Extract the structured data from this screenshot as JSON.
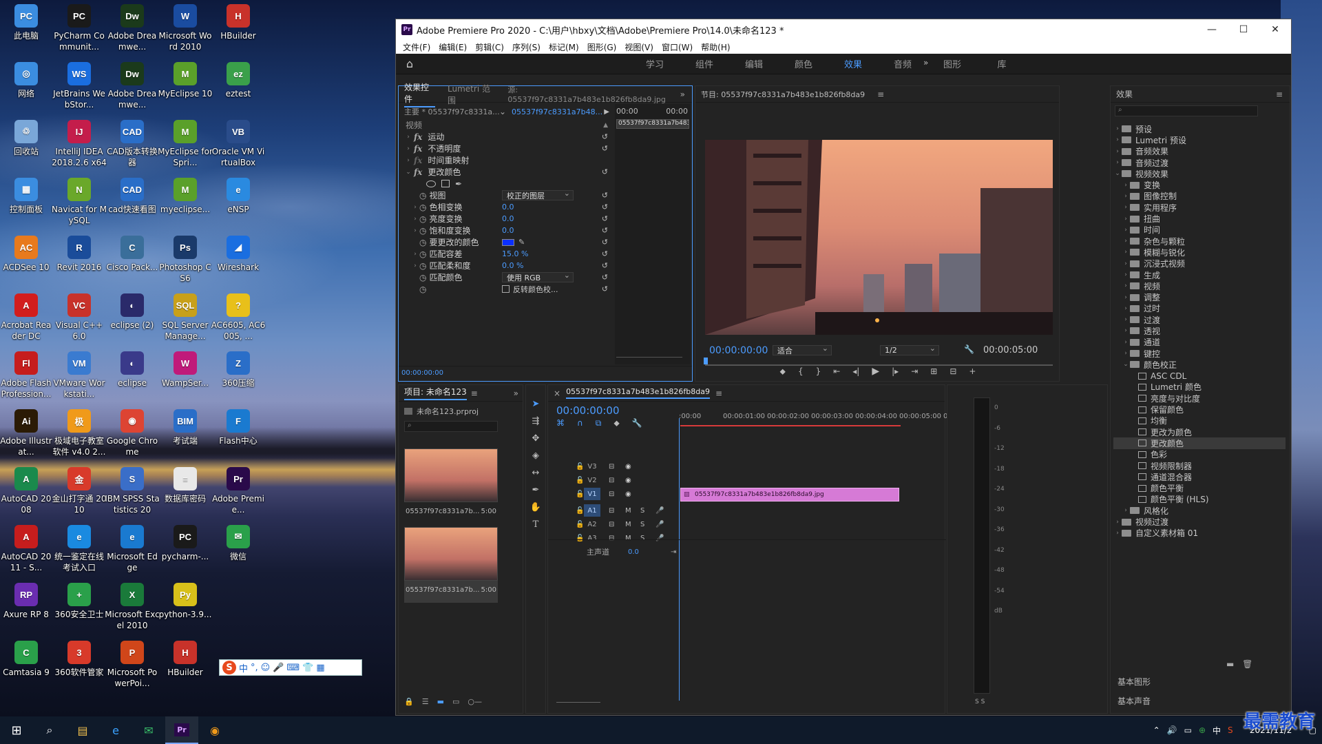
{
  "desktop": {
    "icons": [
      {
        "label": "此电脑",
        "color": "#3b8de0",
        "glyph": "PC"
      },
      {
        "label": "网络",
        "color": "#3b8de0",
        "glyph": "◎"
      },
      {
        "label": "回收站",
        "color": "#7aa7d8",
        "glyph": "♲"
      },
      {
        "label": "控制面板",
        "color": "#3b8de0",
        "glyph": "▦"
      },
      {
        "label": "ACDSee 10",
        "color": "#e87a1d",
        "glyph": "AC"
      },
      {
        "label": "Acrobat Reader DC",
        "color": "#d21d1d",
        "glyph": "A"
      },
      {
        "label": "Adobe Flash Profession...",
        "color": "#c61d1d",
        "glyph": "Fl"
      },
      {
        "label": "Adobe Illustrat...",
        "color": "#2b1b05",
        "glyph": "Ai"
      },
      {
        "label": "AutoCAD 2008",
        "color": "#1a8a4c",
        "glyph": "A"
      },
      {
        "label": "AutoCAD 2011 - S...",
        "color": "#c61d1d",
        "glyph": "A"
      },
      {
        "label": "Axure RP 8",
        "color": "#6a2db0",
        "glyph": "RP"
      },
      {
        "label": "Camtasia 9",
        "color": "#2aa04a",
        "glyph": "C"
      },
      {
        "label": "PyCharm Communit...",
        "color": "#1a1a1a",
        "glyph": "PC"
      },
      {
        "label": "JetBrains WebStor...",
        "color": "#1a6ee0",
        "glyph": "WS"
      },
      {
        "label": "IntelliJ IDEA 2018.2.6 x64",
        "color": "#c41d4b",
        "glyph": "IJ"
      },
      {
        "label": "Navicat for MySQL",
        "color": "#6aa82a",
        "glyph": "N"
      },
      {
        "label": "Revit 2016",
        "color": "#1a4c9a",
        "glyph": "R"
      },
      {
        "label": "Visual C++ 6.0",
        "color": "#c8322a",
        "glyph": "VC"
      },
      {
        "label": "VMware Workstati...",
        "color": "#3a7bd0",
        "glyph": "VM"
      },
      {
        "label": "极域电子教室软件 v4.0 2...",
        "color": "#f09a1a",
        "glyph": "极"
      },
      {
        "label": "金山打字通 2010",
        "color": "#d83a2a",
        "glyph": "金"
      },
      {
        "label": "统一鉴定在线考试入口",
        "color": "#1a8ae0",
        "glyph": "e"
      },
      {
        "label": "360安全卫士",
        "color": "#2aa04a",
        "glyph": "+"
      },
      {
        "label": "360软件管家",
        "color": "#d83a2a",
        "glyph": "3"
      },
      {
        "label": "Adobe Dreamwe...",
        "color": "#1b3a1b",
        "glyph": "Dw"
      },
      {
        "label": "Adobe Dreamwe...",
        "color": "#1b3a1b",
        "glyph": "Dw"
      },
      {
        "label": "CAD版本转换器",
        "color": "#2a6ec8",
        "glyph": "CAD"
      },
      {
        "label": "cad快速看图",
        "color": "#2a6ec8",
        "glyph": "CAD"
      },
      {
        "label": "Cisco Pack...",
        "color": "#3a6e9a",
        "glyph": "C"
      },
      {
        "label": "eclipse (2)",
        "color": "#2a2a6a",
        "glyph": "◐"
      },
      {
        "label": "eclipse",
        "color": "#3a3a8a",
        "glyph": "◐"
      },
      {
        "label": "Google Chrome",
        "color": "#dd4433",
        "glyph": "◉"
      },
      {
        "label": "IBM SPSS Statistics 20",
        "color": "#3a6ec8",
        "glyph": "S"
      },
      {
        "label": "Microsoft Edge",
        "color": "#1a7ad0",
        "glyph": "e"
      },
      {
        "label": "Microsoft Excel 2010",
        "color": "#1a7a3a",
        "glyph": "X"
      },
      {
        "label": "Microsoft PowerPoi...",
        "color": "#d0461a",
        "glyph": "P"
      },
      {
        "label": "Microsoft Word 2010",
        "color": "#1a4ca0",
        "glyph": "W"
      },
      {
        "label": "MyEclipse 10",
        "color": "#5aa02a",
        "glyph": "M"
      },
      {
        "label": "MyEclipse for Spri...",
        "color": "#5aa02a",
        "glyph": "M"
      },
      {
        "label": "myeclipse...",
        "color": "#5aa02a",
        "glyph": "M"
      },
      {
        "label": "Photoshop CS6",
        "color": "#1a3a6a",
        "glyph": "Ps"
      },
      {
        "label": "SQL Server Manage...",
        "color": "#c8a01a",
        "glyph": "SQL"
      },
      {
        "label": "WampSer...",
        "color": "#c01a7a",
        "glyph": "W"
      },
      {
        "label": "考试端",
        "color": "#2a6ec8",
        "glyph": "BIM"
      },
      {
        "label": "数据库密码",
        "color": "#e8e8e8",
        "glyph": "≡"
      },
      {
        "label": "pycharm-...",
        "color": "#1a1a1a",
        "glyph": "PC"
      },
      {
        "label": "python-3.9...",
        "color": "#d8c01a",
        "glyph": "Py"
      },
      {
        "label": "HBuilder",
        "color": "#c8322a",
        "glyph": "H"
      },
      {
        "label": "HBuilder",
        "color": "#c8322a",
        "glyph": "H"
      },
      {
        "label": "eztest",
        "color": "#3aa04a",
        "glyph": "ez"
      },
      {
        "label": "Oracle VM VirtualBox",
        "color": "#2a4c8a",
        "glyph": "VB"
      },
      {
        "label": "eNSP",
        "color": "#2a8ae0",
        "glyph": "e"
      },
      {
        "label": "Wireshark",
        "color": "#1a6ee0",
        "glyph": "◢"
      },
      {
        "label": "AC6605, AC6005, ...",
        "color": "#e8c01a",
        "glyph": "?"
      },
      {
        "label": "360压缩",
        "color": "#2a6ec8",
        "glyph": "Z"
      },
      {
        "label": "Flash中心",
        "color": "#1a7ad0",
        "glyph": "F"
      },
      {
        "label": "Adobe Premie...",
        "color": "#2a0a4a",
        "glyph": "Pr"
      },
      {
        "label": "微信",
        "color": "#2aa04a",
        "glyph": "✉"
      }
    ]
  },
  "taskbar": {
    "time": "",
    "date": "2021/11/2"
  },
  "watermark": "最需教育",
  "ime": {
    "items": [
      "中",
      "°,",
      "☺",
      "🎤",
      "⌨",
      "👕",
      "▦"
    ]
  },
  "premiere": {
    "title": "Adobe Premiere Pro 2020 - C:\\用户\\hbxy\\文档\\Adobe\\Premiere Pro\\14.0\\未命名123 *",
    "menu": [
      "文件(F)",
      "编辑(E)",
      "剪辑(C)",
      "序列(S)",
      "标记(M)",
      "图形(G)",
      "视图(V)",
      "窗口(W)",
      "帮助(H)"
    ],
    "workspaces": [
      "学习",
      "组件",
      "编辑",
      "颜色",
      "效果",
      "音频",
      "图形",
      "库"
    ],
    "workspace_active": "效果",
    "effect_controls": {
      "tabs": [
        "效果控件",
        "Lumetri 范围"
      ],
      "source": "源: 05537f97c8331a7b483e1b826fb8da9.jpg",
      "master": "主要 * 05537f97c8331a...",
      "clip": "05537f97c8331a7b48...",
      "tc_start": "00:00",
      "tc_end": "00:00",
      "clip_bar": "05537f97c8331a7b483e1b826fb8da9.jpg",
      "video_label": "视频",
      "fx_rows": [
        "运动",
        "不透明度",
        "时间重映射",
        "更改颜色"
      ],
      "params": [
        {
          "name": "视图",
          "type": "dropdown",
          "value": "校正的图层"
        },
        {
          "name": "色相变换",
          "type": "value",
          "value": "0.0"
        },
        {
          "name": "亮度变换",
          "type": "value",
          "value": "0.0"
        },
        {
          "name": "饱和度变换",
          "type": "value",
          "value": "0.0"
        },
        {
          "name": "要更改的颜色",
          "type": "color",
          "value": ""
        },
        {
          "name": "匹配容差",
          "type": "value",
          "value": "15.0 %"
        },
        {
          "name": "匹配柔和度",
          "type": "value",
          "value": "0.0 %"
        },
        {
          "name": "匹配颜色",
          "type": "dropdown",
          "value": "使用 RGB"
        },
        {
          "name": "",
          "type": "checkbox",
          "value": "反转颜色校..."
        }
      ],
      "timecode": "00:00:00:00"
    },
    "program": {
      "title": "节目: 05537f97c8331a7b483e1b826fb8da9",
      "timecode": "00:00:00:00",
      "fit": "适合",
      "quality": "1/2",
      "duration": "00:00:05:00"
    },
    "effects": {
      "title": "效果",
      "tree": [
        {
          "label": "预设",
          "level": 0,
          "type": "folder"
        },
        {
          "label": "Lumetri 预设",
          "level": 0,
          "type": "folder"
        },
        {
          "label": "音频效果",
          "level": 0,
          "type": "folder"
        },
        {
          "label": "音频过渡",
          "level": 0,
          "type": "folder"
        },
        {
          "label": "视频效果",
          "level": 0,
          "type": "folder",
          "open": true
        },
        {
          "label": "变换",
          "level": 1,
          "type": "folder"
        },
        {
          "label": "图像控制",
          "level": 1,
          "type": "folder"
        },
        {
          "label": "实用程序",
          "level": 1,
          "type": "folder"
        },
        {
          "label": "扭曲",
          "level": 1,
          "type": "folder"
        },
        {
          "label": "时间",
          "level": 1,
          "type": "folder"
        },
        {
          "label": "杂色与颗粒",
          "level": 1,
          "type": "folder"
        },
        {
          "label": "模糊与锐化",
          "level": 1,
          "type": "folder"
        },
        {
          "label": "沉浸式视频",
          "level": 1,
          "type": "folder"
        },
        {
          "label": "生成",
          "level": 1,
          "type": "folder"
        },
        {
          "label": "视频",
          "level": 1,
          "type": "folder"
        },
        {
          "label": "调整",
          "level": 1,
          "type": "folder"
        },
        {
          "label": "过时",
          "level": 1,
          "type": "folder"
        },
        {
          "label": "过渡",
          "level": 1,
          "type": "folder"
        },
        {
          "label": "透视",
          "level": 1,
          "type": "folder"
        },
        {
          "label": "通道",
          "level": 1,
          "type": "folder"
        },
        {
          "label": "键控",
          "level": 1,
          "type": "folder"
        },
        {
          "label": "颜色校正",
          "level": 1,
          "type": "folder",
          "open": true
        },
        {
          "label": "ASC CDL",
          "level": 2,
          "type": "fx"
        },
        {
          "label": "Lumetri 颜色",
          "level": 2,
          "type": "fx"
        },
        {
          "label": "亮度与对比度",
          "level": 2,
          "type": "fx"
        },
        {
          "label": "保留颜色",
          "level": 2,
          "type": "fx"
        },
        {
          "label": "均衡",
          "level": 2,
          "type": "fx"
        },
        {
          "label": "更改为颜色",
          "level": 2,
          "type": "fx"
        },
        {
          "label": "更改颜色",
          "level": 2,
          "type": "fx",
          "selected": true
        },
        {
          "label": "色彩",
          "level": 2,
          "type": "fx"
        },
        {
          "label": "视频限制器",
          "level": 2,
          "type": "fx"
        },
        {
          "label": "通道混合器",
          "level": 2,
          "type": "fx"
        },
        {
          "label": "颜色平衡",
          "level": 2,
          "type": "fx"
        },
        {
          "label": "颜色平衡 (HLS)",
          "level": 2,
          "type": "fx"
        },
        {
          "label": "风格化",
          "level": 1,
          "type": "folder"
        },
        {
          "label": "视频过渡",
          "level": 0,
          "type": "folder"
        },
        {
          "label": "自定义素材箱 01",
          "level": 0,
          "type": "folder"
        }
      ],
      "basic_graphics": "基本图形",
      "basic_sound": "基本声音"
    },
    "project": {
      "title": "项目: 未命名123",
      "file": "未命名123.prproj",
      "items": [
        {
          "name": "05537f97c8331a7b...",
          "dur": "5:00"
        },
        {
          "name": "05537f97c8331a7b...",
          "dur": "5:00"
        }
      ]
    },
    "timeline": {
      "title": "05537f97c8331a7b483e1b826fb8da9",
      "timecode": "00:00:00:00",
      "ruler": [
        ":00:00",
        "00:00:01:00",
        "00:00:02:00",
        "00:00:03:00",
        "00:00:04:00",
        "00:00:05:00",
        "00:00:"
      ],
      "video_tracks": [
        "V3",
        "V2",
        "V1"
      ],
      "audio_tracks": [
        "A1",
        "A2",
        "A3"
      ],
      "master_label": "主声道",
      "master_value": "0.0",
      "clip": "05537f97c8331a7b483e1b826fb8da9.jpg",
      "clip_color": "#d67ad6"
    },
    "meter": {
      "scale": [
        "0",
        "-6",
        "-12",
        "-18",
        "-24",
        "-30",
        "-36",
        "-42",
        "-48",
        "-54",
        "dB"
      ],
      "solo": "S S"
    }
  }
}
